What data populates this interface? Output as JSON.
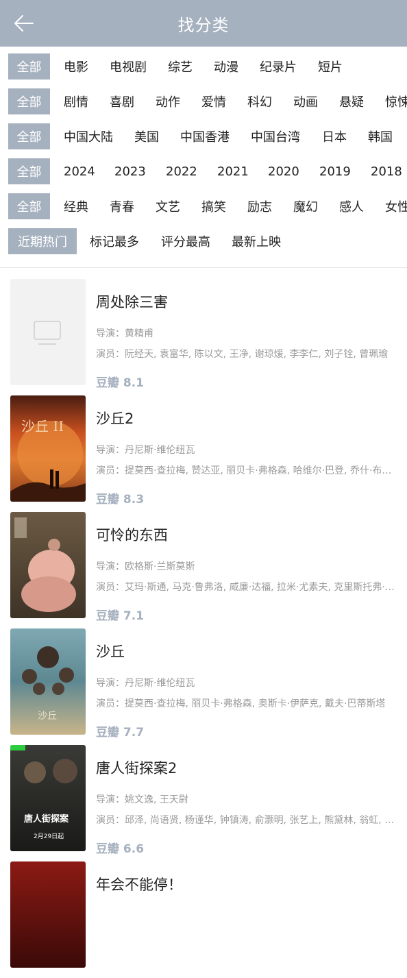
{
  "header": {
    "title": "找分类",
    "back_icon": "arrow-left-icon"
  },
  "filters": {
    "row1": [
      "全部",
      "电影",
      "电视剧",
      "综艺",
      "动漫",
      "纪录片",
      "短片"
    ],
    "row2": [
      "全部",
      "剧情",
      "喜剧",
      "动作",
      "爱情",
      "科幻",
      "动画",
      "悬疑",
      "惊悚"
    ],
    "row3": [
      "全部",
      "中国大陆",
      "美国",
      "中国香港",
      "中国台湾",
      "日本",
      "韩国"
    ],
    "row4": [
      "全部",
      "2024",
      "2023",
      "2022",
      "2021",
      "2020",
      "2019",
      "2018"
    ],
    "row5": [
      "全部",
      "经典",
      "青春",
      "文艺",
      "搞笑",
      "励志",
      "魔幻",
      "感人",
      "女性"
    ],
    "row6": [
      "近期热门",
      "标记最多",
      "评分最高",
      "最新上映"
    ]
  },
  "movies": [
    {
      "title": "周处除三害",
      "director": "导演：黄精甫",
      "cast": "演员：阮经天, 袁富华, 陈以文, 王净, 谢琼煖, 李李仁, 刘子铨, 曾珮瑜",
      "score": "豆瓣 8.1"
    },
    {
      "title": "沙丘2",
      "director": "导演：丹尼斯·维伦纽瓦",
      "cast": "演员：提莫西·查拉梅, 赞达亚, 丽贝卡·弗格森, 哈维尔·巴登, 乔什·布洛林",
      "score": "豆瓣 8.3",
      "poster_text": "沙丘 II"
    },
    {
      "title": "可怜的东西",
      "director": "导演：欧格斯·兰斯莫斯",
      "cast": "演员：艾玛·斯通, 马克·鲁弗洛, 威廉·达福, 拉米·尤素夫, 克里斯托弗·阿波特",
      "score": "豆瓣 7.1"
    },
    {
      "title": "沙丘",
      "director": "导演：丹尼斯·维伦纽瓦",
      "cast": "演员：提莫西·查拉梅, 丽贝卡·弗格森, 奥斯卡·伊萨克, 戴夫·巴蒂斯塔",
      "score": "豆瓣 7.7",
      "poster_text": "沙丘"
    },
    {
      "title": "唐人街探案2",
      "director": "导演：姚文逸, 王天尉",
      "cast": "演员：邱泽, 尚语贤, 杨谨华, 钟镇涛, 俞灏明, 张艺上, 熊黛林, 翁虹, 王传君",
      "score": "豆瓣 6.6",
      "poster_text": "唐人街探案",
      "poster_date": "2月29日起"
    },
    {
      "title": "年会不能停！"
    }
  ]
}
